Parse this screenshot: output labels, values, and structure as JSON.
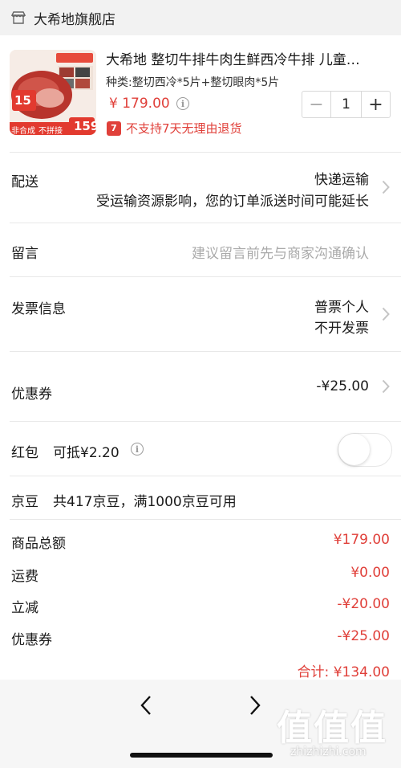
{
  "store": {
    "name": "大希地旗舰店",
    "icon": "store-icon"
  },
  "product": {
    "title": "大希地 整切牛排牛肉生鲜西冷牛排 儿童…",
    "spec": "种类:整切西冷*5片+整切眼肉*5片",
    "price": "¥ 179.00",
    "price_info_icon": "i",
    "quantity": "1",
    "minus": "−",
    "plus": "+",
    "no_return_icon": "7",
    "no_return_text": "不支持7天无理由退货",
    "thumb": {
      "badge_top": "15",
      "tag_left": "非合成",
      "tag_mid": "不拼接",
      "tag_price": "159"
    }
  },
  "delivery": {
    "label": "配送",
    "method": "快递运输",
    "notice": "受运输资源影响，您的订单派送时间可能延长"
  },
  "message": {
    "label": "留言",
    "placeholder": "建议留言前先与商家沟通确认"
  },
  "invoice": {
    "label": "发票信息",
    "line1": "普票个人",
    "line2": "不开发票"
  },
  "coupon": {
    "label": "优惠券",
    "value": "-¥25.00"
  },
  "redpacket": {
    "label": "红包",
    "deductible": "可抵¥2.20",
    "info_icon": "i",
    "enabled": false
  },
  "jingdou": {
    "label": "京豆",
    "text": "共417京豆，满1000京豆可用"
  },
  "summary": {
    "items": [
      {
        "label": "商品总额",
        "value": "¥179.00"
      },
      {
        "label": "运费",
        "value": "¥0.00"
      },
      {
        "label": "立减",
        "value": "-¥20.00"
      },
      {
        "label": "优惠券",
        "value": "-¥25.00"
      }
    ],
    "total": "合计: ¥134.00"
  },
  "nav": {
    "back_icon": "chevron-left-icon",
    "forward_icon": "chevron-right-icon"
  },
  "watermark": {
    "text": "值值值",
    "url": "zhizhizhi.com"
  },
  "colors": {
    "accent": "#e0403a",
    "muted": "#aaaaaa"
  }
}
